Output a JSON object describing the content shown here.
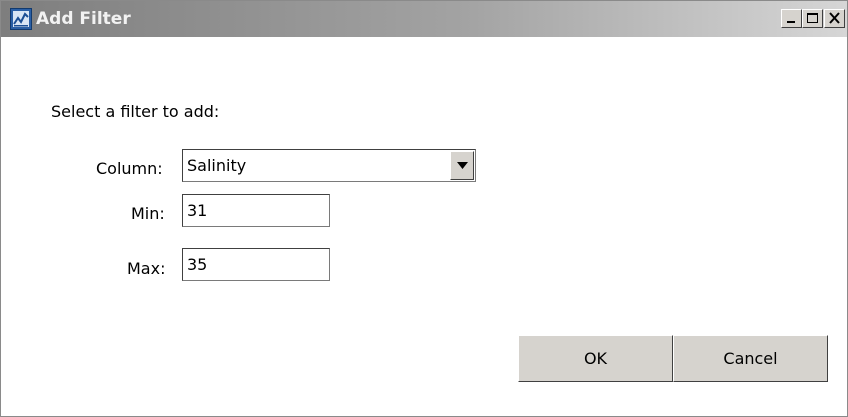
{
  "window": {
    "title": "Add Filter",
    "controls": [
      "minimize-icon",
      "maximize-icon",
      "close-icon"
    ]
  },
  "form": {
    "prompt": "Select a filter to add:",
    "column_label": "Column:",
    "column_value": "Salinity",
    "min_label": "Min:",
    "min_value": "31",
    "max_label": "Max:",
    "max_value": "35"
  },
  "buttons": {
    "ok": "OK",
    "cancel": "Cancel"
  },
  "colors": {
    "titlebar_start": "#7e7e7e",
    "titlebar_end": "#d6d6d6",
    "button_face": "#d6d3ce"
  }
}
